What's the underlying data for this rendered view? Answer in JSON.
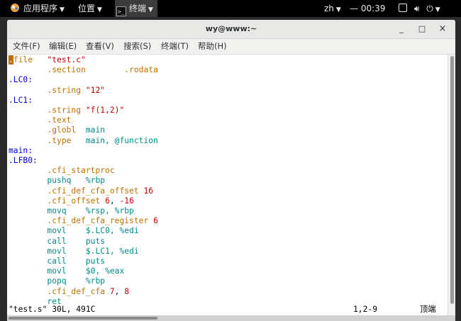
{
  "panel": {
    "apps_label": "应用程序",
    "places_label": "位置",
    "task_label": "终端",
    "lang": "zh",
    "clock": "— 00:39",
    "icons": [
      "applications-icon",
      "terminal-icon",
      "display-icon",
      "volume-icon",
      "power-icon"
    ]
  },
  "window": {
    "title": "wy@www:~",
    "minimize": "_",
    "maximize": "□",
    "close": "×"
  },
  "menu": {
    "file": "文件(F)",
    "edit": "编辑(E)",
    "view": "查看(V)",
    "search": "搜索(S)",
    "terminal": "终端(T)",
    "help": "帮助(H)"
  },
  "editor": {
    "lines": [
      [
        [
          "cursor",
          "."
        ],
        [
          "dir",
          "file"
        ],
        [
          "plain",
          "   "
        ],
        [
          "str",
          "\"test.c\""
        ]
      ],
      [
        [
          "plain",
          "        "
        ],
        [
          "dir",
          ".section"
        ],
        [
          "plain",
          "        "
        ],
        [
          "dir",
          ".rodata"
        ]
      ],
      [
        [
          "lbl",
          ".LC0:"
        ]
      ],
      [
        [
          "plain",
          "        "
        ],
        [
          "dir",
          ".string"
        ],
        [
          "plain",
          " "
        ],
        [
          "str",
          "\"12\""
        ]
      ],
      [
        [
          "lbl",
          ".LC1:"
        ]
      ],
      [
        [
          "plain",
          "        "
        ],
        [
          "dir",
          ".string"
        ],
        [
          "plain",
          " "
        ],
        [
          "str",
          "\"f(1,2)\""
        ]
      ],
      [
        [
          "plain",
          "        "
        ],
        [
          "dir",
          ".text"
        ]
      ],
      [
        [
          "plain",
          "        "
        ],
        [
          "dir",
          ".globl"
        ],
        [
          "plain",
          "  "
        ],
        [
          "kw",
          "main"
        ]
      ],
      [
        [
          "plain",
          "        "
        ],
        [
          "dir",
          ".type"
        ],
        [
          "plain",
          "   "
        ],
        [
          "kw",
          "main, @function"
        ]
      ],
      [
        [
          "lbl",
          "main:"
        ]
      ],
      [
        [
          "lbl",
          ".LFB0:"
        ]
      ],
      [
        [
          "plain",
          "        "
        ],
        [
          "dir",
          ".cfi_startproc"
        ]
      ],
      [
        [
          "plain",
          "        "
        ],
        [
          "kw",
          "pushq"
        ],
        [
          "plain",
          "   "
        ],
        [
          "kw",
          "%rbp"
        ]
      ],
      [
        [
          "plain",
          "        "
        ],
        [
          "dir",
          ".cfi_def_cfa_offset"
        ],
        [
          "plain",
          " "
        ],
        [
          "num",
          "16"
        ]
      ],
      [
        [
          "plain",
          "        "
        ],
        [
          "dir",
          ".cfi_offset"
        ],
        [
          "plain",
          " "
        ],
        [
          "num",
          "6"
        ],
        [
          "plain",
          ", "
        ],
        [
          "num",
          "-16"
        ]
      ],
      [
        [
          "plain",
          "        "
        ],
        [
          "kw",
          "movq"
        ],
        [
          "plain",
          "    "
        ],
        [
          "kw",
          "%rsp, %rbp"
        ]
      ],
      [
        [
          "plain",
          "        "
        ],
        [
          "dir",
          ".cfi_def_cfa_register"
        ],
        [
          "plain",
          " "
        ],
        [
          "num",
          "6"
        ]
      ],
      [
        [
          "plain",
          "        "
        ],
        [
          "kw",
          "movl"
        ],
        [
          "plain",
          "    "
        ],
        [
          "kw",
          "$.LC0, %edi"
        ]
      ],
      [
        [
          "plain",
          "        "
        ],
        [
          "kw",
          "call"
        ],
        [
          "plain",
          "    "
        ],
        [
          "kw",
          "puts"
        ]
      ],
      [
        [
          "plain",
          "        "
        ],
        [
          "kw",
          "movl"
        ],
        [
          "plain",
          "    "
        ],
        [
          "kw",
          "$.LC1, %edi"
        ]
      ],
      [
        [
          "plain",
          "        "
        ],
        [
          "kw",
          "call"
        ],
        [
          "plain",
          "    "
        ],
        [
          "kw",
          "puts"
        ]
      ],
      [
        [
          "plain",
          "        "
        ],
        [
          "kw",
          "movl"
        ],
        [
          "plain",
          "    "
        ],
        [
          "kw",
          "$0, %eax"
        ]
      ],
      [
        [
          "plain",
          "        "
        ],
        [
          "kw",
          "popq"
        ],
        [
          "plain",
          "    "
        ],
        [
          "kw",
          "%rbp"
        ]
      ],
      [
        [
          "plain",
          "        "
        ],
        [
          "dir",
          ".cfi_def_cfa"
        ],
        [
          "plain",
          " "
        ],
        [
          "num",
          "7"
        ],
        [
          "plain",
          ", "
        ],
        [
          "num",
          "8"
        ]
      ],
      [
        [
          "plain",
          "        "
        ],
        [
          "kw",
          "ret"
        ]
      ]
    ]
  },
  "status": {
    "file_info": "\"test.s\" 30L, 491C",
    "position": "1,2-9",
    "scroll": "顶端"
  },
  "colors": {
    "directive": "#c07000",
    "string": "#c00000",
    "keyword": "#008b8b",
    "label": "#0000d0"
  }
}
